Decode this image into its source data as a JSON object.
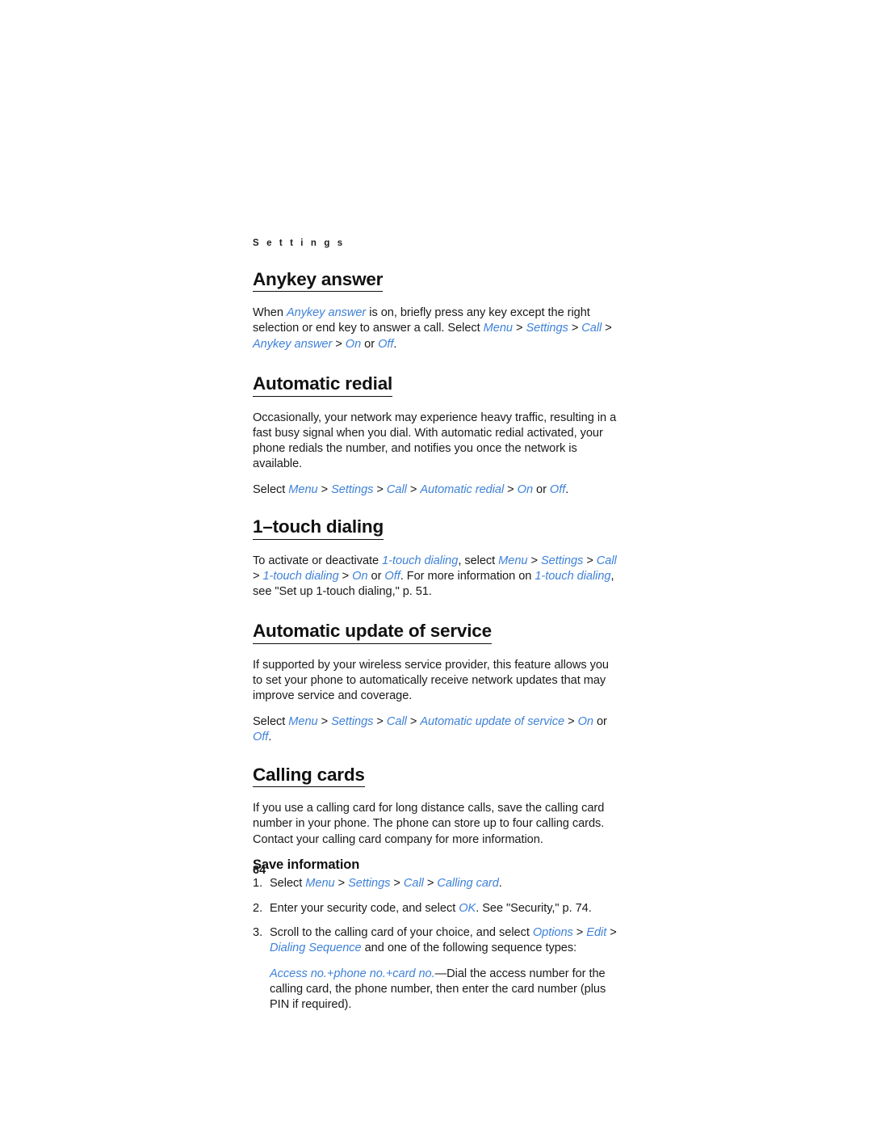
{
  "document": {
    "running_head": "S e t t i n g s",
    "running_head_plain": "Settings",
    "page_number": "64",
    "accent_color": "#3f82d8",
    "text_color": "#1a1a1a"
  },
  "sections": {
    "anykey": {
      "title": "Anykey answer",
      "para1_a": "When ",
      "para1_em1": "Anykey answer",
      "para1_b": " is on, briefly press any key except the right selection or end key to answer a call. Select ",
      "para1_em2": "Menu",
      "gt1": " > ",
      "para1_em3": "Settings",
      "gt2": " > ",
      "para1_em4": "Call",
      "gt3": " > ",
      "para1_em5": "Anykey answer",
      "gt4": " > ",
      "para1_em6": "On",
      "para1_or": " or ",
      "para1_em7": "Off",
      "para1_end": "."
    },
    "auto_redial": {
      "title": "Automatic redial",
      "para1": "Occasionally, your network may experience heavy traffic, resulting in a fast busy signal when you dial. With automatic redial activated, your phone redials the number, and notifies you once the network is available.",
      "select_prefix": "Select ",
      "em1": "Menu",
      "gt1": " > ",
      "em2": "Settings",
      "gt2": " > ",
      "em3": "Call",
      "gt3": " > ",
      "em4": "Automatic redial",
      "gt4": " > ",
      "em5": "On",
      "or": " or ",
      "em6": "Off",
      "end": "."
    },
    "one_touch": {
      "title": "1–touch dialing",
      "para_a": "To activate or deactivate ",
      "em1": "1-touch dialing",
      "para_b": ", select ",
      "em2": "Menu",
      "gt1": " > ",
      "em3": "Settings",
      "gt2": " > ",
      "em4": "Call",
      "gt3": " > ",
      "em5": "1-touch dialing",
      "gt4": " > ",
      "em6": "On",
      "or": " or ",
      "em7": "Off",
      "para_c": ". For more information on ",
      "em8": "1-touch dialing",
      "para_d": ", see \"Set up 1-touch dialing,\" p. 51."
    },
    "auto_update": {
      "title": "Automatic update of service",
      "para1": "If supported by your wireless service provider, this feature allows you to set your phone to automatically receive network updates that may improve service and coverage.",
      "select_prefix": "Select ",
      "em1": "Menu",
      "gt1": " > ",
      "em2": "Settings",
      "gt2": " > ",
      "em3": "Call",
      "gt3": " > ",
      "em4": "Automatic update of service",
      "gt4": " > ",
      "em5": "On",
      "or": " or ",
      "em6": "Off",
      "end": "."
    },
    "calling_cards": {
      "title": "Calling cards",
      "para1": "If you use a calling card for long distance calls, save the calling card number in your phone. The phone can store up to four calling cards. Contact your calling card company for more information.",
      "sub_title": "Save information",
      "step1": {
        "num": "1.",
        "a": "Select ",
        "em1": "Menu",
        "gt1": " > ",
        "em2": "Settings",
        "gt2": " > ",
        "em3": "Call",
        "gt3": " > ",
        "em4": "Calling card",
        "end": "."
      },
      "step2": {
        "num": "2.",
        "a": "Enter your security code, and select ",
        "em1": "OK",
        "b": ". See \"Security,\" p. 74."
      },
      "step3": {
        "num": "3.",
        "a": "Scroll to the calling card of your choice, and select ",
        "em1": "Options",
        "gt1": " > ",
        "em2": "Edit",
        "gt2": " > ",
        "em3": "Dialing Sequence",
        "b": " and one of the following sequence types:"
      },
      "note": {
        "em1": "Access no.+phone no.+card no.",
        "a": "—Dial the access number for the calling card, the phone number, then enter the card number (plus PIN if required)."
      }
    }
  }
}
